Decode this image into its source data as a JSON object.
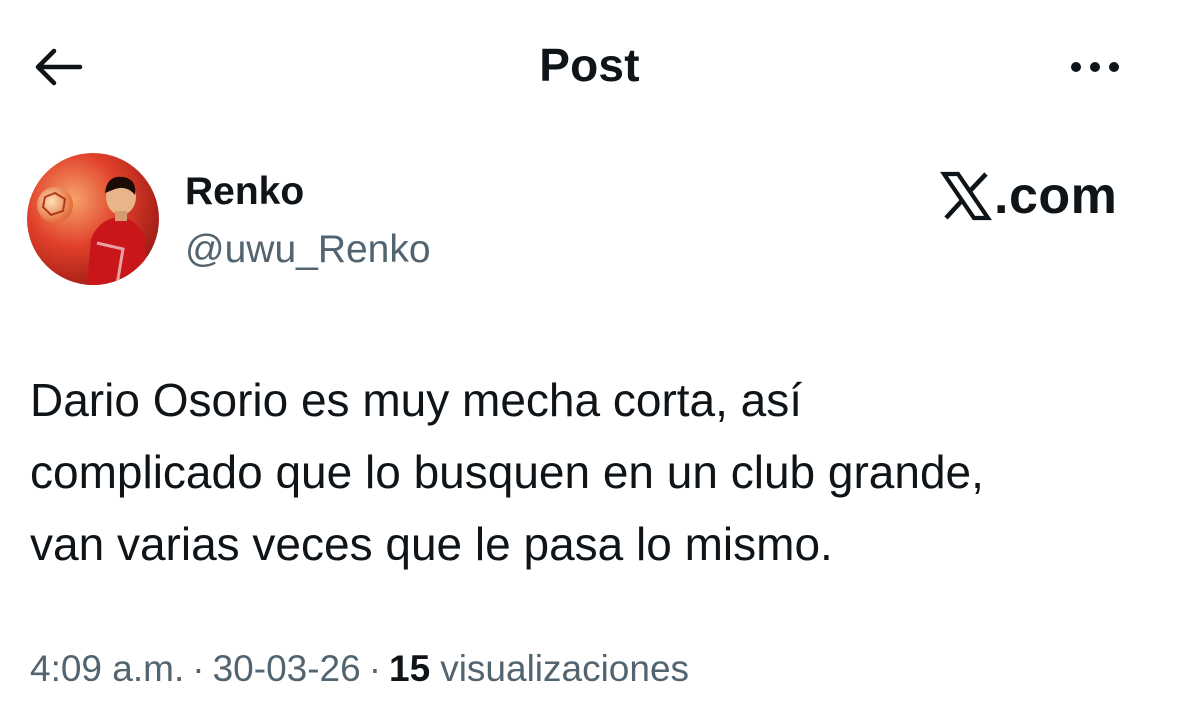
{
  "header": {
    "title": "Post",
    "back_icon": "arrow-left-icon",
    "more_icon": "more-horizontal-icon"
  },
  "author": {
    "display_name": "Renko",
    "handle": "@uwu_Renko",
    "avatar_icon": "avatar-football-player"
  },
  "brand": {
    "icon": "x-logo-icon",
    "text": ".com"
  },
  "post": {
    "lines": [
      "Dario Osorio es muy mecha corta, así",
      "complicado que lo busquen en un club grande,",
      "van varias veces que le pasa lo mismo."
    ]
  },
  "meta": {
    "time": "4:09 a.m.",
    "separator": "·",
    "date": "30-03-26",
    "views_count": "15",
    "views_label": "visualizaciones"
  },
  "colors": {
    "text_primary": "#0f1419",
    "text_secondary": "#536471",
    "background": "#ffffff",
    "avatar_red": "#d7261e"
  }
}
